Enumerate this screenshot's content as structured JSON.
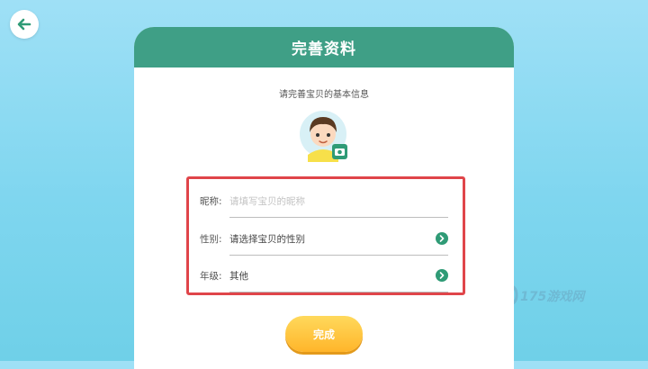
{
  "header": {
    "title": "完善资料"
  },
  "subtitle": "请完善宝贝的基本信息",
  "form": {
    "nickname_label": "昵称:",
    "nickname_placeholder": "请填写宝贝的昵称",
    "gender_label": "性别:",
    "gender_value": "请选择宝贝的性别",
    "grade_label": "年级:",
    "grade_value": "其他"
  },
  "done_label": "完成",
  "watermark": "175游戏网",
  "icons": [
    "back-arrow-icon",
    "avatar-icon",
    "camera-icon",
    "chevron-right-icon"
  ],
  "colors": {
    "header": "#3f9f86",
    "highlight_border": "#e0454a",
    "button": "#ffb52a",
    "chevron": "#2f9b76"
  }
}
